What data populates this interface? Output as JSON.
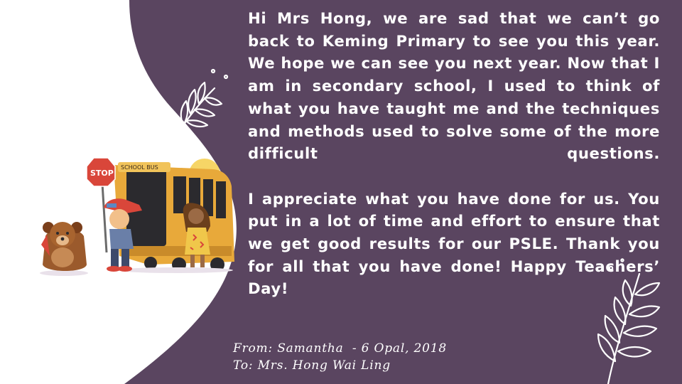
{
  "message": {
    "paragraph1": "Hi Mrs Hong,  we are sad that we can’t go back to Keming Primary to see you this year.  We hope we can see you next year. Now that I am in secondary school, I used to think of what you have taught me and the techniques and methods used to solve some of the more difficult questions.",
    "paragraph2": "I appreciate what you have done for us. You put in a lot of time and effort to ensure that we get good results for our PSLE. Thank you for all that you have done! Happy Teachers’ Day!"
  },
  "signature": {
    "from": "From: Samantha  - 6 Opal, 2018",
    "to": "To: Mrs. Hong Wai Ling"
  },
  "illustration": {
    "stop_sign": "STOP",
    "bus_sign": "SCHOOL BUS"
  },
  "colors": {
    "background": "#5a4560",
    "white_shape": "#ffffff",
    "text": "#ffffff",
    "bus": "#e8a93a",
    "stop": "#d9463a"
  },
  "icons": [
    "leaf-sprig-icon",
    "leaf-sprig-icon"
  ]
}
